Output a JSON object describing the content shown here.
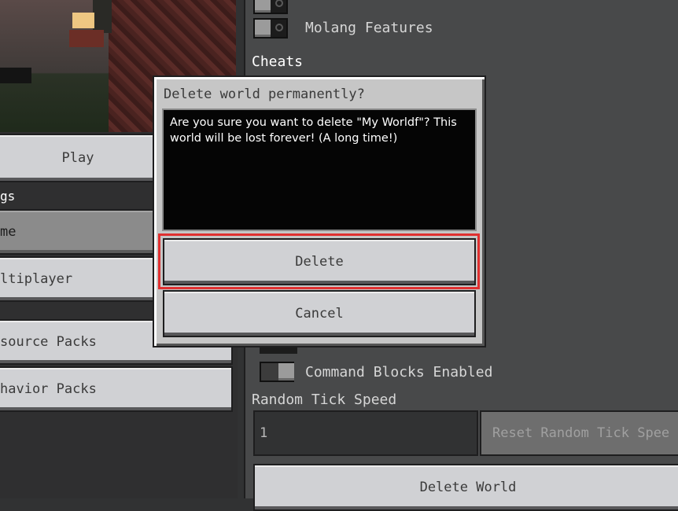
{
  "left_panel": {
    "play_label": "Play",
    "settings_label": "gs",
    "tabs": [
      {
        "label": "me"
      },
      {
        "label": "ltiplayer"
      },
      {
        "label": "source Packs"
      },
      {
        "label": "havior Packs"
      }
    ]
  },
  "right_panel": {
    "top_toggles": [
      {
        "label": "Molang Features",
        "on": false
      }
    ],
    "cheats_label": "Cheats",
    "command_blocks_label": "Command Blocks Enabled",
    "random_tick": {
      "label": "Random Tick Speed",
      "value": "1",
      "reset_label": "Reset Random Tick Spee"
    },
    "delete_world_label": "Delete World"
  },
  "dialog": {
    "title": "Delete world permanently?",
    "message": "Are you sure you want to delete \"My Worldf\"? This world will be lost forever! (A long time!)",
    "delete_label": "Delete",
    "cancel_label": "Cancel",
    "highlight_color": "#e03030"
  }
}
